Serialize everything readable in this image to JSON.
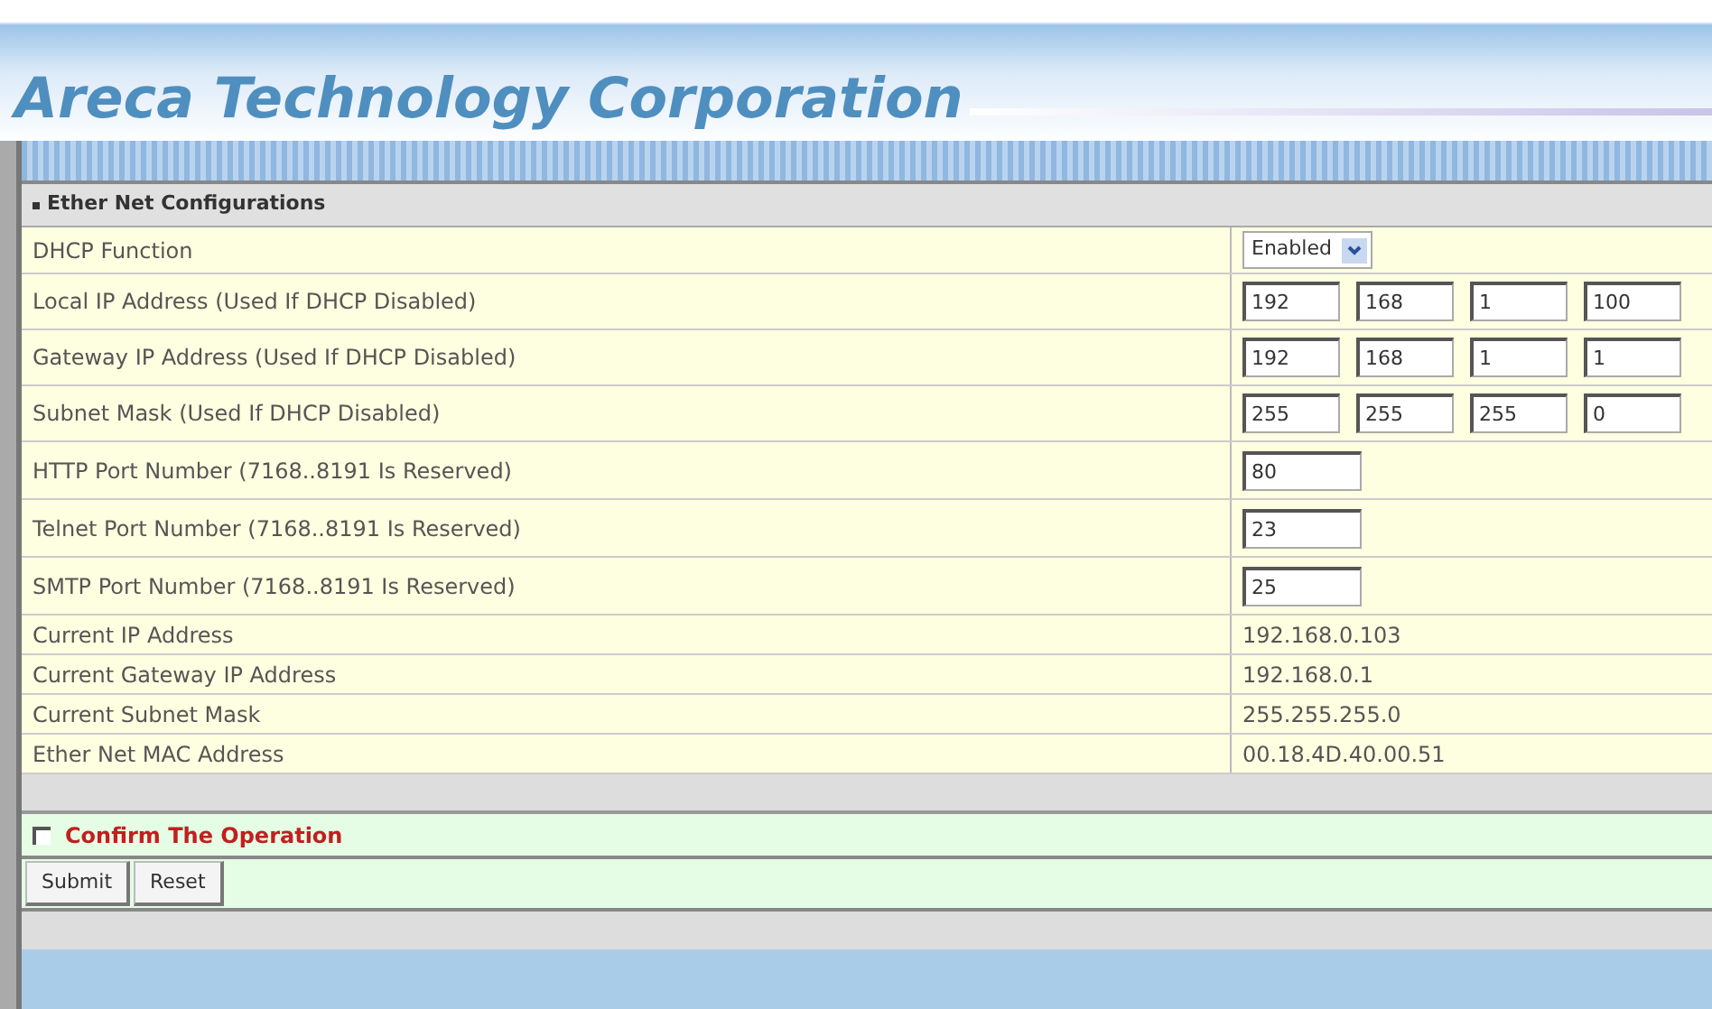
{
  "header": {
    "title": "Areca Technology Corporation"
  },
  "section": {
    "title": "Ether Net Configurations"
  },
  "rows": [
    {
      "kind": "select",
      "label": "DHCP Function",
      "value": "Enabled"
    },
    {
      "kind": "ip",
      "label": "Local IP Address (Used If DHCP Disabled)",
      "octets": [
        "192",
        "168",
        "1",
        "100"
      ]
    },
    {
      "kind": "ip",
      "label": "Gateway IP Address (Used If DHCP Disabled)",
      "octets": [
        "192",
        "168",
        "1",
        "1"
      ]
    },
    {
      "kind": "ip",
      "label": "Subnet Mask (Used If DHCP Disabled)",
      "octets": [
        "255",
        "255",
        "255",
        "0"
      ]
    },
    {
      "kind": "port",
      "label": "HTTP Port Number (7168..8191 Is Reserved)",
      "value": "80"
    },
    {
      "kind": "port",
      "label": "Telnet Port Number (7168..8191 Is Reserved)",
      "value": "23"
    },
    {
      "kind": "port",
      "label": "SMTP Port Number (7168..8191 Is Reserved)",
      "value": "25"
    },
    {
      "kind": "info",
      "label": "Current IP Address",
      "value": "192.168.0.103"
    },
    {
      "kind": "info",
      "label": "Current Gateway IP Address",
      "value": "192.168.0.1"
    },
    {
      "kind": "info",
      "label": "Current Subnet Mask",
      "value": "255.255.255.0"
    },
    {
      "kind": "info",
      "label": "Ether Net MAC Address",
      "value": "00.18.4D.40.00.51"
    }
  ],
  "confirm": {
    "label": "Confirm The Operation",
    "checked": false
  },
  "buttons": [
    "Submit",
    "Reset"
  ]
}
